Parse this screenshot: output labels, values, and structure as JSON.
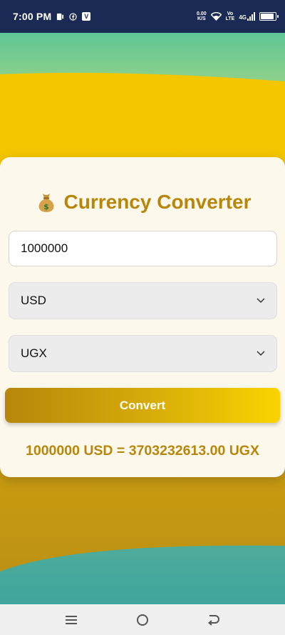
{
  "status_bar": {
    "time": "7:00 PM",
    "net_speed_value": "0.00",
    "net_speed_unit": "K/S",
    "volte_top": "Vo",
    "volte_bottom": "LTE",
    "network_type": "4G",
    "icons": [
      "sim-icon",
      "facebook-icon",
      "app-v-icon",
      "wifi-icon",
      "signal-icon",
      "battery-icon"
    ]
  },
  "app": {
    "title_icon": "money-bag-icon",
    "title": "Currency Converter",
    "amount_value": "1000000",
    "from_currency": "USD",
    "to_currency": "UGX",
    "convert_label": "Convert",
    "result": "1000000 USD = 3703232613.00 UGX"
  },
  "nav_bar": {
    "icons": [
      "menu-icon",
      "home-icon",
      "back-icon"
    ]
  },
  "colors": {
    "status_bar": "#1b2a55",
    "accent_gold": "#b8860b",
    "yellow": "#f9d400",
    "teal": "#4aae9b",
    "card_bg": "#fdf8ec"
  }
}
